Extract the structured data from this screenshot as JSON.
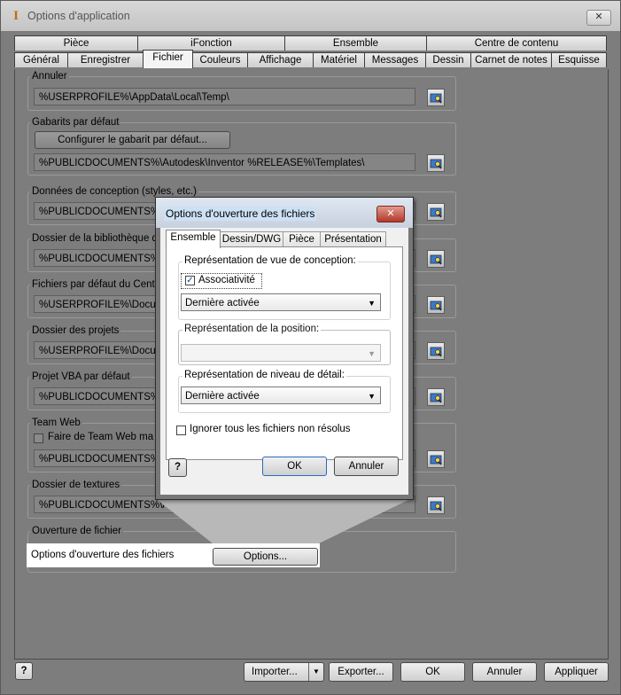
{
  "window": {
    "title": "Options d'application",
    "close_glyph": "✕"
  },
  "tabs_row1": [
    "Pièce",
    "iFonction",
    "Ensemble",
    "Centre de contenu"
  ],
  "tabs_row2": [
    "Général",
    "Enregistrer",
    "Fichier",
    "Couleurs",
    "Affichage",
    "Matériel",
    "Messages",
    "Dessin",
    "Carnet de notes",
    "Esquisse"
  ],
  "sections": {
    "annuler": {
      "label": "Annuler",
      "path": "%USERPROFILE%\\AppData\\Local\\Temp\\"
    },
    "gabarits": {
      "label": "Gabarits par défaut",
      "button": "Configurer le gabarit par défaut...",
      "path": "%PUBLICDOCUMENTS%\\Autodesk\\Inventor %RELEASE%\\Templates\\"
    },
    "donnees": {
      "label": "Données de conception (styles, etc.)",
      "path": "%PUBLICDOCUMENTS%\\Autodesk\\Inventor %RELEASE%\\Design Data\\"
    },
    "biblio": {
      "label": "Dossier de la bibliothèque de",
      "path": "%PUBLICDOCUMENTS%\\Autodesk\\Inventor %RELEASE%\\Content Center Files\\"
    },
    "centre": {
      "label": "Fichiers par défaut du Centre",
      "path": "%USERPROFILE%\\Documents\\Inventor\\Content Center Files\\"
    },
    "projets": {
      "label": "Dossier des projets",
      "path": "%USERPROFILE%\\Documents\\Inventor\\"
    },
    "vba": {
      "label": "Projet VBA par défaut",
      "path": "%PUBLICDOCUMENTS%\\Autodesk\\Inventor %RELEASE%\\"
    },
    "teamweb": {
      "label": "Team Web",
      "checkbox": "Faire de Team Web ma page",
      "path": "%PUBLICDOCUMENTS%\\Autodesk\\Inventor %RELEASE%\\"
    },
    "textures": {
      "label": "Dossier de textures",
      "path": "%PUBLICDOCUMENTS%\\Autodesk\\Inventor %RELEASE%\\Textures\\"
    },
    "ouverture": {
      "label": "Ouverture de fichier",
      "row_label": "Options d'ouverture des fichiers",
      "button": "Options..."
    }
  },
  "footer": {
    "help": "?",
    "import": "Importer...",
    "import_arrow": "▼",
    "export": "Exporter...",
    "ok": "OK",
    "cancel": "Annuler",
    "apply": "Appliquer"
  },
  "dialog": {
    "title": "Options d'ouverture des fichiers",
    "close_glyph": "✕",
    "tabs": [
      "Ensemble",
      "Dessin/DWG",
      "Pièce",
      "Présentation"
    ],
    "vue": {
      "label": "Représentation de vue de conception:",
      "checkbox": "Associativité",
      "checked": true,
      "value": "Dernière activée"
    },
    "position": {
      "label": "Représentation de la position:",
      "value": ""
    },
    "niveau": {
      "label": "Représentation de niveau de détail:",
      "value": "Dernière activée"
    },
    "ignorer": "Ignorer tous les fichiers non résolus",
    "help": "?",
    "ok": "OK",
    "cancel": "Annuler"
  },
  "icons": {
    "browse": "folder-browse-icon",
    "combo_arrow": "▼",
    "check": "✓"
  }
}
